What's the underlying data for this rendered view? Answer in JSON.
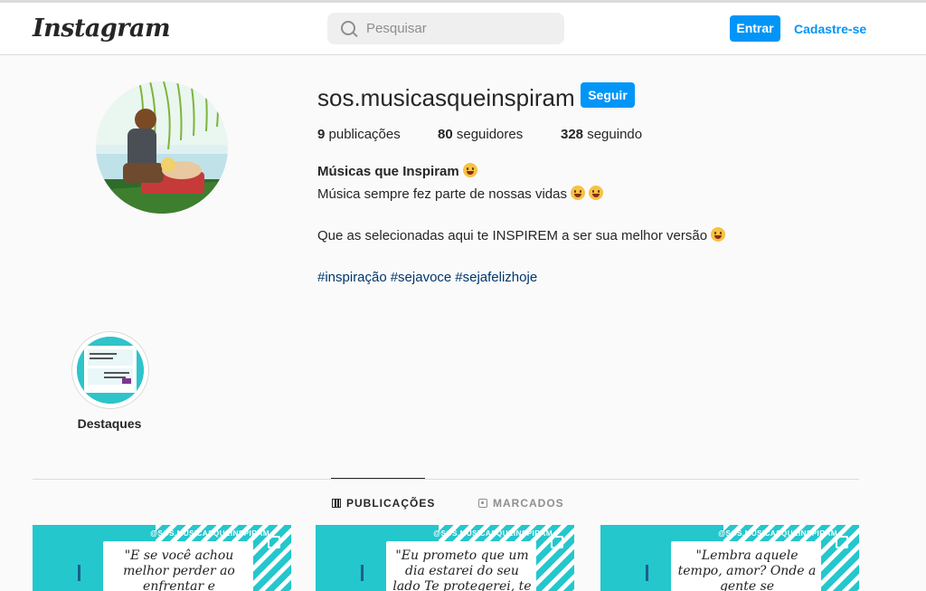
{
  "header": {
    "logo": "Instagram",
    "search_placeholder": "Pesquisar",
    "login_button": "Entrar",
    "signup_link": "Cadastre-se"
  },
  "profile": {
    "username": "sos.musicasqueinspiram",
    "follow_button": "Seguir",
    "stats": [
      {
        "count": "9",
        "label": "publicações"
      },
      {
        "count": "80",
        "label": "seguidores"
      },
      {
        "count": "328",
        "label": "seguindo"
      }
    ],
    "bio_name": "Músicas que Inspiram",
    "bio_lines": [
      "Música sempre fez parte de nossas vidas",
      "Que as selecionadas aqui te INSPIREM a ser sua melhor versão"
    ],
    "hashtags": [
      "#inspiração",
      "#sejavoce",
      "#sejafelizhoje"
    ]
  },
  "highlights": [
    {
      "label": "Destaques"
    }
  ],
  "tabs": [
    {
      "label": "PUBLICAÇÕES",
      "active": true,
      "icon": "grid-icon"
    },
    {
      "label": "MARCADOS",
      "active": false,
      "icon": "tag-icon"
    }
  ],
  "posts": [
    {
      "handle": "@SOS.MUSICASQUEINSPIRAM",
      "quote": "\"E se você achou melhor perder ao enfrentar e"
    },
    {
      "handle": "@SOS.MUSICASQUEINSPIRAM",
      "quote": "\"Eu prometo que um dia estarei do seu lado Te protegerei, te"
    },
    {
      "handle": "@SOS.MUSICASQUEINSPIRAM",
      "quote": "\"Lembra aquele tempo, amor? Onde a gente se"
    }
  ],
  "colors": {
    "accent": "#0095f6",
    "hashtag": "#00376b",
    "post_bg": "#24c7cc"
  }
}
